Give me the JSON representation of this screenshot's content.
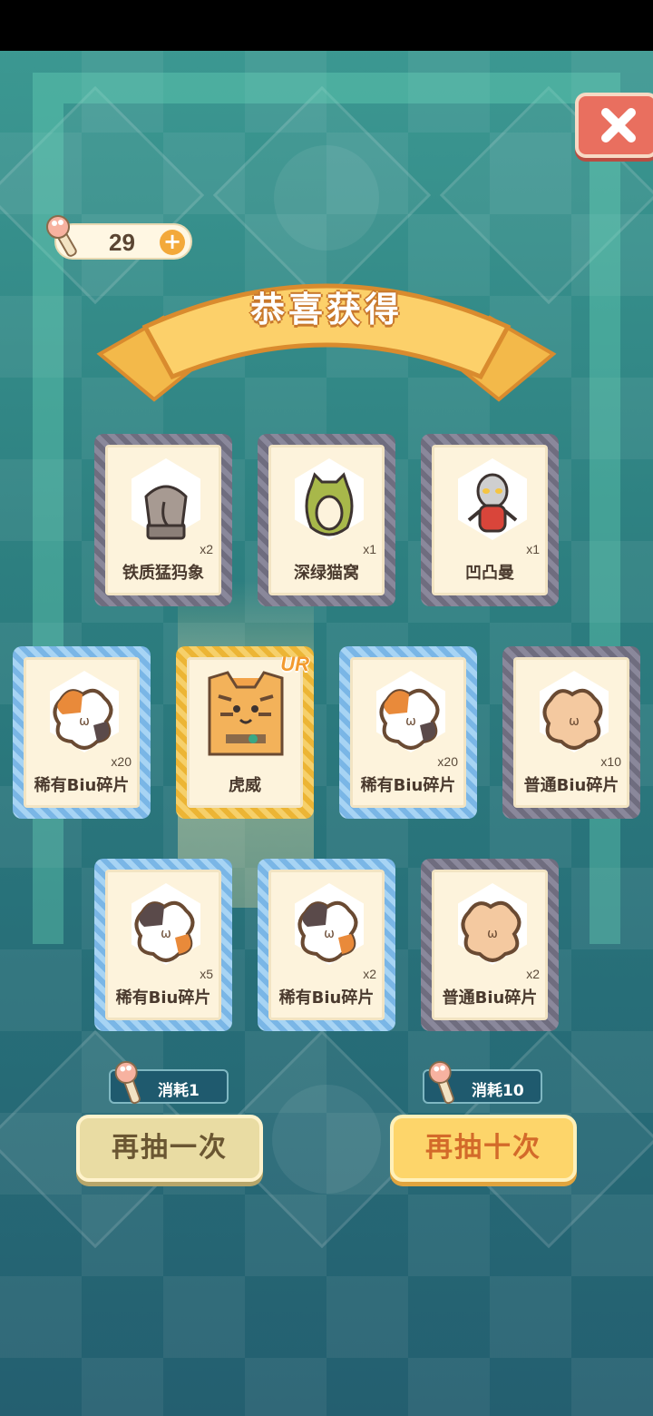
{
  "currency": {
    "amount": "29",
    "plus": "+"
  },
  "banner": {
    "title": "恭喜获得"
  },
  "cards": [
    {
      "name": "铁质猛犸象",
      "qty": "x2",
      "rarity": "gray",
      "art": "elephant-statue"
    },
    {
      "name": "深绿猫窝",
      "qty": "x1",
      "rarity": "gray",
      "art": "cat-bed"
    },
    {
      "name": "凹凸曼",
      "qty": "x1",
      "rarity": "gray",
      "art": "hero-figure"
    },
    {
      "name": "稀有Biu碎片",
      "qty": "x20",
      "rarity": "blue",
      "art": "calico-puzzle"
    },
    {
      "name": "虎威",
      "qty": "",
      "rarity": "gold",
      "badge": "UR",
      "art": "tiger-cat"
    },
    {
      "name": "稀有Biu碎片",
      "qty": "x20",
      "rarity": "blue",
      "art": "calico-puzzle"
    },
    {
      "name": "普通Biu碎片",
      "qty": "x10",
      "rarity": "gray",
      "art": "tan-puzzle"
    },
    {
      "name": "稀有Biu碎片",
      "qty": "x5",
      "rarity": "blue",
      "art": "calico-puzzle"
    },
    {
      "name": "稀有Biu碎片",
      "qty": "x2",
      "rarity": "blue",
      "art": "calico-puzzle"
    },
    {
      "name": "普通Biu碎片",
      "qty": "x2",
      "rarity": "gray",
      "art": "tan-puzzle"
    }
  ],
  "actions": {
    "once": {
      "cost_label": "消耗1",
      "button_label": "再抽一次"
    },
    "ten": {
      "cost_label": "消耗10",
      "button_label": "再抽十次"
    }
  },
  "colors": {
    "gray_frame": "#7c7a8a",
    "blue_frame": "#8fc5ee",
    "gold_frame": "#f3c44c",
    "accent": "#f3a93a"
  }
}
